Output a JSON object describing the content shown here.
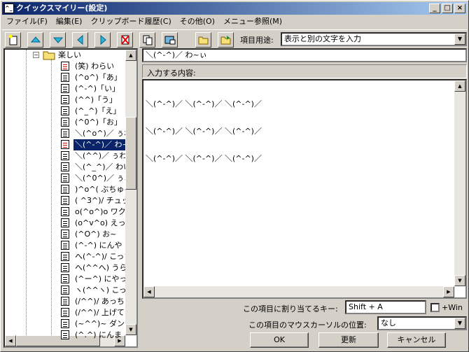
{
  "title": "クイックスマイリー(設定)",
  "window_controls": {
    "minimize": "_",
    "maximize": "□",
    "close": "×"
  },
  "menu": [
    "ファイル(F)",
    "編集(E)",
    "クリップボード履歴(C)",
    "その他(O)",
    "メニュー参照(M)"
  ],
  "toolbar": {
    "purpose_label": "項目用途:",
    "purpose_value": "表示と別の文字を入力"
  },
  "tree": {
    "folder": "楽しい",
    "items": [
      {
        "text": "(笑) わらい",
        "red": true
      },
      {
        "text": "(^o^)「あ」"
      },
      {
        "text": "(^-^)「い」"
      },
      {
        "text": "(^^)「う」"
      },
      {
        "text": "(^_^)「え」"
      },
      {
        "text": "(^0^)「お」"
      },
      {
        "text": "＼(^o^)／ ぅわ~"
      },
      {
        "text": "＼(^-^)／ わ~ぃ",
        "red": true,
        "selected": true
      },
      {
        "text": "＼(^^)／ ぅわ~"
      },
      {
        "text": "＼(^_^)／ わい"
      },
      {
        "text": "＼(^0^)／ ぅお"
      },
      {
        "text": ")^o^( ぶちゅ~"
      },
      {
        "text": "( ^3^)/ チュッ"
      },
      {
        "text": "o(^o^)o ワクワ"
      },
      {
        "text": "(o^v^o) えっへ"
      },
      {
        "text": "(^O^) お~"
      },
      {
        "text": "(^-^) にんや"
      },
      {
        "text": "へ(^-^)/ こっち"
      },
      {
        "text": "へ(^^へ) うらめ"
      },
      {
        "text": "(^ー^) にやっ"
      },
      {
        "text": "ヽ(^^ヽ) こっち"
      },
      {
        "text": "(/^^)/ あっち"
      },
      {
        "text": "(/^^)/ 上げて"
      },
      {
        "text": "(~^^)~ ダン"
      },
      {
        "text": "(^.^) にんま"
      }
    ]
  },
  "display_text": "＼(^-^)／ わ~ぃ",
  "content_label": "入力する内容:",
  "content_lines": [
    "＼(^-^)／ ＼(^-^)／ ＼(^-^)／",
    "＼(^-^)／ ＼(^-^)／ ＼(^-^)／",
    "＼(^-^)／ ＼(^-^)／ ＼(^-^)／"
  ],
  "hotkey": {
    "label": "この項目に割り当てるキー:",
    "value": "Shift + A",
    "win_label": "+Win"
  },
  "cursor": {
    "label": "この項目のマウスカーソルの位置:",
    "value": "なし"
  },
  "buttons": {
    "ok": "OK",
    "update": "更新",
    "cancel": "キャンセル"
  }
}
